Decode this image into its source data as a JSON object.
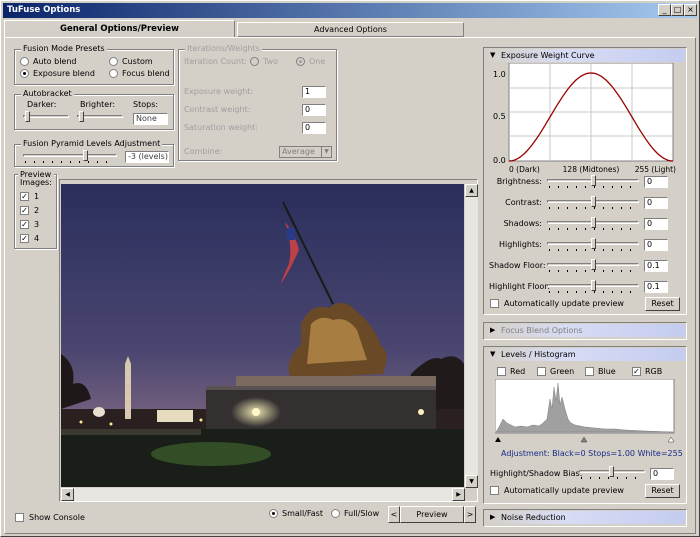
{
  "window": {
    "title": "TuFuse Options",
    "controls": [
      "_",
      "□",
      "×"
    ]
  },
  "tabs": {
    "general": "General Options/Preview",
    "advanced": "Advanced Options"
  },
  "fusion_mode": {
    "title": "Fusion Mode Presets",
    "auto": "Auto blend",
    "custom": "Custom",
    "exposure": "Exposure blend",
    "focus": "Focus blend",
    "selected": "Exposure blend"
  },
  "iterations": {
    "title": "Iterations/Weights",
    "count_label": "Iteration Count:",
    "two": "Two",
    "one": "One",
    "exposure_label": "Exposure weight:",
    "exposure_value": "1",
    "contrast_label": "Contrast weight:",
    "contrast_value": "0",
    "saturation_label": "Saturation weight:",
    "saturation_value": "0",
    "combine_label": "Combine:",
    "combine_value": "Average"
  },
  "autobracket": {
    "title": "Autobracket",
    "darker": "Darker:",
    "brighter": "Brighter:",
    "stops": "Stops:",
    "stops_value": "None"
  },
  "pyramid": {
    "title": "Fusion Pyramid Levels Adjustment",
    "value": "-3 (levels)"
  },
  "preview_images": {
    "title": "Preview Images:",
    "items": [
      {
        "label": "1",
        "checked": true
      },
      {
        "label": "2",
        "checked": true
      },
      {
        "label": "3",
        "checked": true
      },
      {
        "label": "4",
        "checked": true
      }
    ]
  },
  "bottom": {
    "show_console": "Show Console",
    "small_fast": "Small/Fast",
    "full_slow": "Full/Slow",
    "preview_button": "Preview",
    "prev": "<",
    "next": ">"
  },
  "exposure_curve": {
    "title": "Exposure Weight Curve",
    "y_ticks": [
      "1.0",
      "0.5",
      "0.0"
    ],
    "x_labels": [
      "0 (Dark)",
      "128 (Midtones)",
      "255 (Light)"
    ],
    "rows": [
      {
        "label": "Brightness:",
        "value": "0",
        "level": 0.5
      },
      {
        "label": "Contrast:",
        "value": "0",
        "level": 0.5
      },
      {
        "label": "Shadows:",
        "value": "0",
        "level": 0.5
      },
      {
        "label": "Highlights:",
        "value": "0",
        "level": 0.5
      },
      {
        "label": "Shadow Floor:",
        "value": "0.1",
        "level": 0.5
      },
      {
        "label": "Highlight Floor:",
        "value": "0.1",
        "level": 0.5
      }
    ],
    "auto_update": "Automatically update preview",
    "reset": "Reset",
    "curve_color": "#990000"
  },
  "focus_blend": {
    "title": "Focus Blend Options"
  },
  "levels": {
    "title": "Levels / Histogram",
    "red": "Red",
    "green": "Green",
    "blue": "Blue",
    "rgb": "RGB",
    "adjustment": "Adjustment: Black=0    Stops=1.00   White=255",
    "bias_label": "Highlight/Shadow Bias:",
    "bias_value": "0",
    "auto_update": "Automatically update preview",
    "reset": "Reset"
  },
  "noise": {
    "title": "Noise Reduction"
  }
}
